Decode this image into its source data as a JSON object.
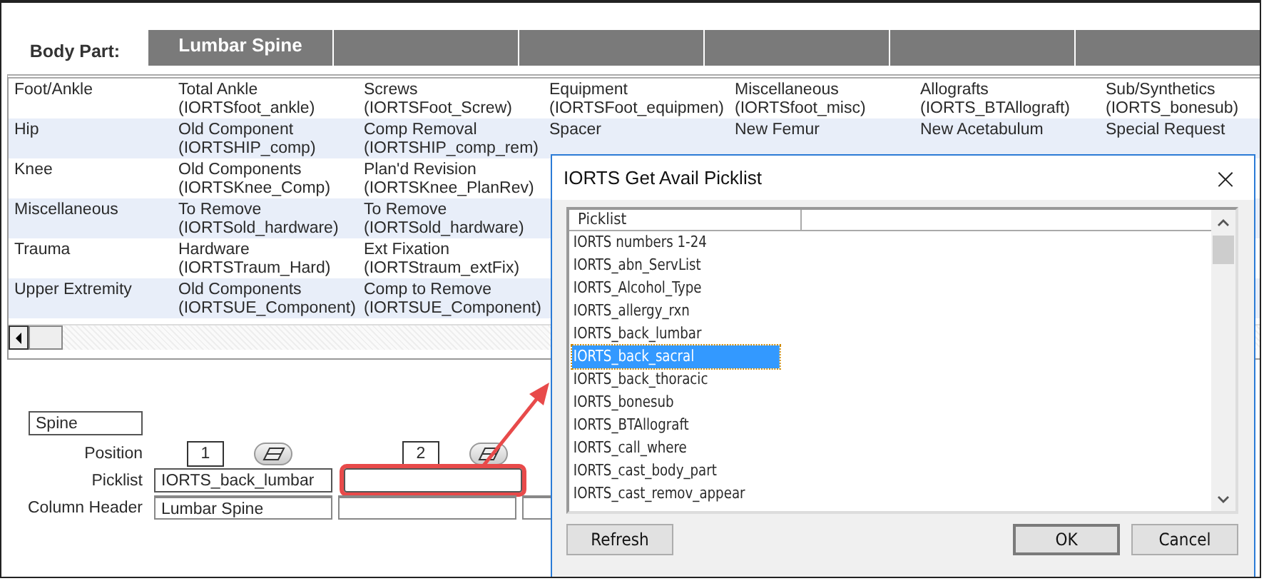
{
  "body_part": {
    "label": "Body Part:",
    "first_header": "Lumbar Spine"
  },
  "grid": {
    "rows": [
      {
        "category": "Foot/Ankle",
        "shaded": false,
        "cells": [
          {
            "title": "Total Ankle",
            "code": "(IORTSfoot_ankle)"
          },
          {
            "title": "Screws",
            "code": "(IORTSFoot_Screw)"
          },
          {
            "title": "Equipment",
            "code": "(IORTSFoot_equipmen)"
          },
          {
            "title": "Miscellaneous",
            "code": "(IORTSfoot_misc)"
          },
          {
            "title": "Allografts",
            "code": "(IORTS_BTAllograft)"
          },
          {
            "title": "Sub/Synthetics",
            "code": "(IORTS_bonesub)"
          }
        ]
      },
      {
        "category": "Hip",
        "shaded": true,
        "cells": [
          {
            "title": "Old Component",
            "code": "(IORTSHIP_comp)"
          },
          {
            "title": "Comp Removal",
            "code": "(IORTSHIP_comp_rem)"
          },
          {
            "title": "Spacer"
          },
          {
            "title": "New Femur"
          },
          {
            "title": "New Acetabulum"
          },
          {
            "title": "Special Request"
          }
        ]
      },
      {
        "category": "Knee",
        "shaded": false,
        "cells": [
          {
            "title": "Old Components",
            "code": "(IORTSKnee_Comp)"
          },
          {
            "title": "Plan'd Revision",
            "code": "(IORTSKnee_PlanRev)"
          }
        ]
      },
      {
        "category": "Miscellaneous",
        "shaded": true,
        "cells": [
          {
            "title": "To Remove",
            "code": "(IORTSold_hardware)"
          },
          {
            "title": "To Remove",
            "code": "(IORTSold_hardware)"
          }
        ]
      },
      {
        "category": "Trauma",
        "shaded": false,
        "cells": [
          {
            "title": "Hardware",
            "code": "(IORTSTraum_Hard)"
          },
          {
            "title": "Ext Fixation",
            "code": "(IORTStraum_extFix)"
          }
        ]
      },
      {
        "category": "Upper Extremity",
        "shaded": true,
        "cells": [
          {
            "title": "Old Components",
            "code": "(IORTSUE_Component)"
          },
          {
            "title": "Comp to Remove",
            "code": "(IORTSUE_Component)"
          }
        ]
      }
    ]
  },
  "editor": {
    "name_value": "Spine",
    "position_label": "Position",
    "positions": [
      "1",
      "2"
    ],
    "picklist_label": "Picklist",
    "picklists": [
      {
        "value": "IORTS_back_lumbar",
        "highlighted": false
      },
      {
        "highlighted": true
      }
    ],
    "column_header_label": "Column Header",
    "column_header_value": "Lumbar Spine"
  },
  "dialog": {
    "title": "IORTS Get Avail Picklist",
    "close": "×",
    "column": "Picklist",
    "items": [
      {
        "text": "IORTS numbers 1-24",
        "selected": false
      },
      {
        "text": "IORTS_abn_ServList",
        "selected": false
      },
      {
        "text": "IORTS_Alcohol_Type",
        "selected": false
      },
      {
        "text": "IORTS_allergy_rxn",
        "selected": false
      },
      {
        "text": "IORTS_back_lumbar",
        "selected": false
      },
      {
        "text": "IORTS_back_sacral",
        "selected": true
      },
      {
        "text": "IORTS_back_thoracic",
        "selected": false
      },
      {
        "text": "IORTS_bonesub",
        "selected": false
      },
      {
        "text": "IORTS_BTAllograft",
        "selected": false
      },
      {
        "text": "IORTS_call_where",
        "selected": false
      },
      {
        "text": "IORTS_cast_body_part",
        "selected": false
      },
      {
        "text": "IORTS_cast_remov_appear",
        "selected": false
      }
    ],
    "buttons": {
      "left": "Refresh",
      "ok": "OK",
      "cancel": "Cancel"
    }
  }
}
